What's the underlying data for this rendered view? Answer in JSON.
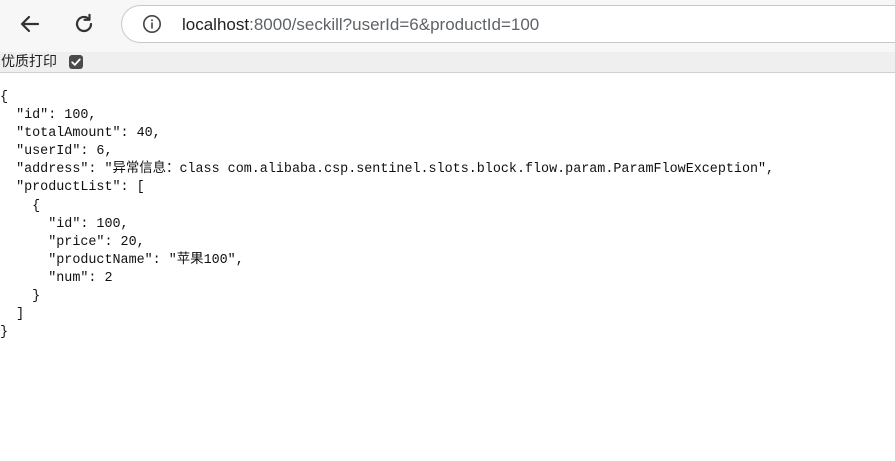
{
  "browser": {
    "url_host": "localhost",
    "url_rest": ":8000/seckill?userId=6&productId=100"
  },
  "print_bar": {
    "label": "优质打印",
    "checked": true
  },
  "json_lines": [
    "{",
    "  \"id\": 100,",
    "  \"totalAmount\": 40,",
    "  \"userId\": 6,",
    "  \"address\": \"异常信息：class com.alibaba.csp.sentinel.slots.block.flow.param.ParamFlowException\",",
    "  \"productList\": [",
    "    {",
    "      \"id\": 100,",
    "      \"price\": 20,",
    "      \"productName\": \"苹果100\",",
    "      \"num\": 2",
    "    }",
    "  ]",
    "}"
  ],
  "icons": {
    "back": "arrow-left-icon",
    "reload": "reload-icon",
    "info": "info-icon",
    "check": "checkmark-icon"
  }
}
